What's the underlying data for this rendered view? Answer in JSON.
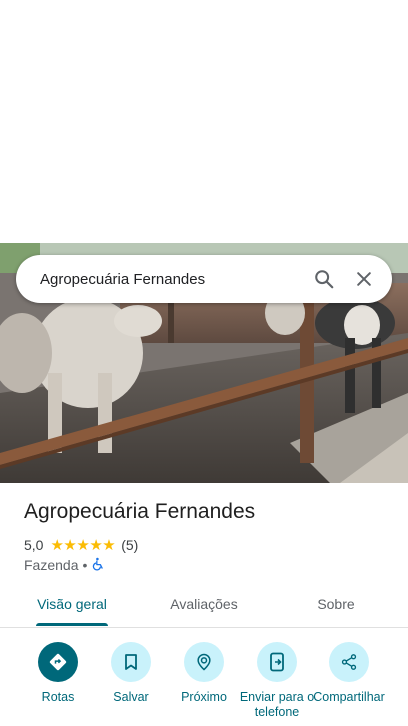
{
  "search": {
    "query": "Agropecuária Fernandes"
  },
  "place": {
    "name": "Agropecuária Fernandes",
    "rating": "5,0",
    "stars": 5,
    "review_count": "(5)",
    "category": "Fazenda",
    "separator": "•"
  },
  "tabs": [
    {
      "label": "Visão geral",
      "active": true
    },
    {
      "label": "Avaliações",
      "active": false
    },
    {
      "label": "Sobre",
      "active": false
    }
  ],
  "actions": [
    {
      "label": "Rotas",
      "icon": "directions-icon",
      "primary": true
    },
    {
      "label": "Salvar",
      "icon": "bookmark-icon",
      "primary": false
    },
    {
      "label": "Próximo",
      "icon": "nearby-icon",
      "primary": false
    },
    {
      "label": "Enviar para o telefone",
      "icon": "send-to-phone-icon",
      "primary": false
    },
    {
      "label": "Compartilhar",
      "icon": "share-icon",
      "primary": false
    }
  ],
  "colors": {
    "accent": "#00687a",
    "action_bg": "#c9f2fb",
    "star": "#fbbc04"
  }
}
